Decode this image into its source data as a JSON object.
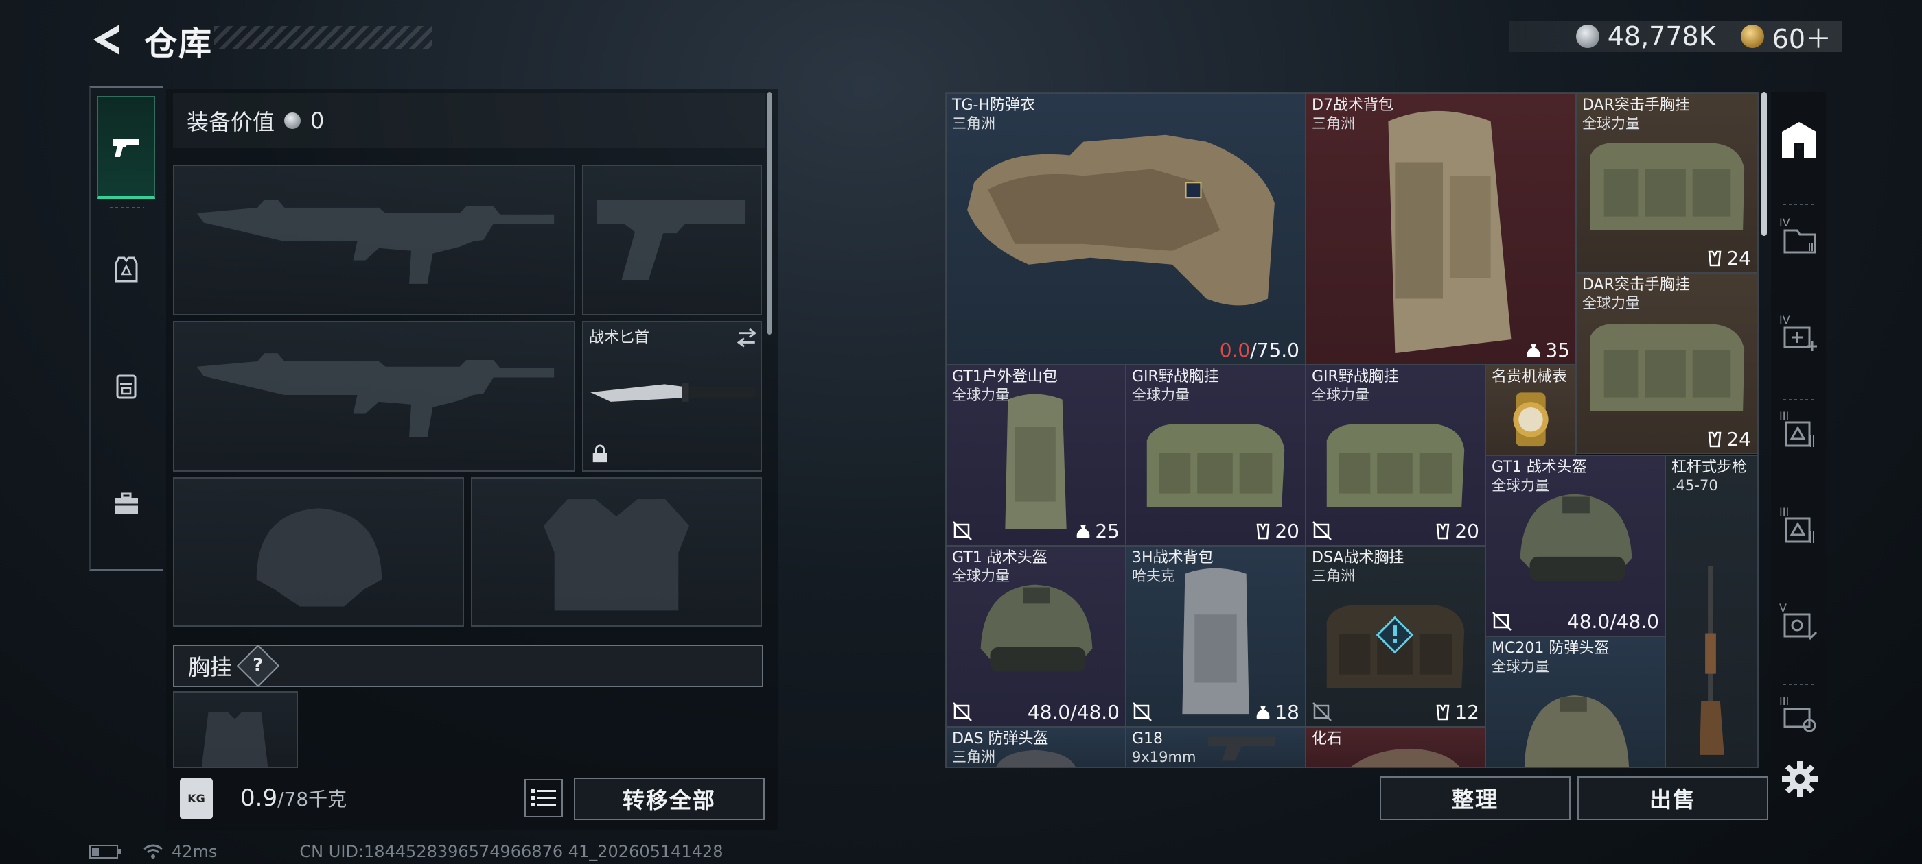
{
  "header": {
    "title": "仓库",
    "silver_amount": "48,778K",
    "gold_amount": "60＋"
  },
  "equipment": {
    "value_label": "装备价值",
    "value": "0",
    "knife_label": "战术匕首",
    "rig_section_label": "胸挂",
    "rig_help": "?"
  },
  "footer_left": {
    "kg_icon": "KG",
    "weight_value": "0.9",
    "weight_capacity": "/78千克",
    "transfer_all_label": "转移全部"
  },
  "stash": {
    "items": [
      {
        "name": "TG-H防弹衣",
        "sub": "三角洲",
        "durability_current": "0.0",
        "durability_max": "/75.0",
        "bg": "blue"
      },
      {
        "name": "D7战术背包",
        "sub": "三角洲",
        "count": "35",
        "bg": "red"
      },
      {
        "name": "DAR突击手胸挂",
        "sub": "全球力量",
        "count": "24",
        "bg": "brown"
      },
      {
        "name": "DAR突击手胸挂",
        "sub": "全球力量",
        "count": "24",
        "bg": "brown"
      },
      {
        "name": "GT1户外登山包",
        "sub": "全球力量",
        "count": "25",
        "bg": "purple"
      },
      {
        "name": "GIR野战胸挂",
        "sub": "全球力量",
        "count": "20",
        "bg": "purple"
      },
      {
        "name": "GIR野战胸挂",
        "sub": "全球力量",
        "count": "20",
        "bg": "purple"
      },
      {
        "name": "名贵机械表",
        "sub": "",
        "bg": "brown"
      },
      {
        "name": "GT1 战术头盔",
        "sub": "全球力量",
        "durability": "48.0/48.0",
        "bg": "purple"
      },
      {
        "name": "杠杆式步枪",
        "sub": ".45-70",
        "bg": "dark"
      },
      {
        "name": "GT1 战术头盔",
        "sub": "全球力量",
        "durability": "48.0/48.0",
        "bg": "purple"
      },
      {
        "name": "3H战术背包",
        "sub": "哈夫克",
        "count": "18",
        "bg": "blue"
      },
      {
        "name": "DSA战术胸挂",
        "sub": "三角洲",
        "count": "12",
        "bg": "dark"
      },
      {
        "name": "MC201 防弹头盔",
        "sub": "全球力量",
        "bg": "blue"
      },
      {
        "name": "DAS 防弹头盔",
        "sub": "三角洲",
        "bg": "blue"
      },
      {
        "name": "G18",
        "sub": "9x19mm",
        "bg": "blue"
      },
      {
        "name": "化石",
        "sub": "",
        "bg": "red"
      }
    ],
    "sort_label": "整理",
    "sell_label": "出售"
  },
  "status_bar": {
    "ping": "42ms",
    "uid": "CN UID:1844528396574966876 41_202605141428"
  },
  "colors": {
    "accent_green": "#35d09a",
    "damaged_red": "#e2484a",
    "rarity_blue": "#28384a",
    "rarity_red": "#4a2429",
    "rarity_brown": "#463b31",
    "rarity_purple": "#2e2c44"
  }
}
